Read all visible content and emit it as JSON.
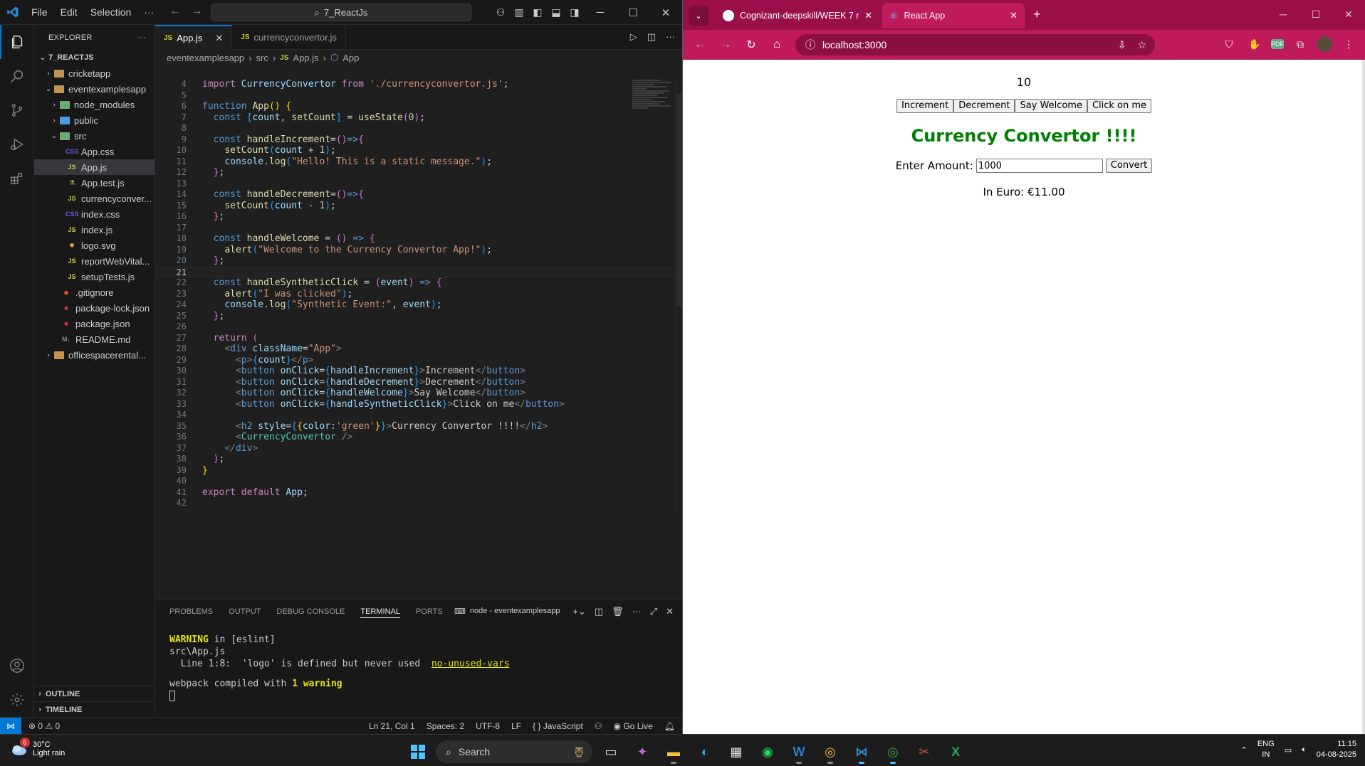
{
  "vscode": {
    "menu": [
      "File",
      "Edit",
      "Selection",
      "···"
    ],
    "search_text": "7_ReactJs",
    "explorer_title": "EXPLORER",
    "explorer_more": "···",
    "tree": [
      {
        "label": "7_REACTJS",
        "depth": 0,
        "kind": "root",
        "open": true
      },
      {
        "label": "cricketapp",
        "depth": 1,
        "kind": "folder",
        "open": false
      },
      {
        "label": "eventexamplesapp",
        "depth": 1,
        "kind": "folder",
        "open": true
      },
      {
        "label": "node_modules",
        "depth": 2,
        "kind": "folder-green",
        "open": false
      },
      {
        "label": "public",
        "depth": 2,
        "kind": "folder-blue",
        "open": false
      },
      {
        "label": "src",
        "depth": 2,
        "kind": "folder-green",
        "open": true
      },
      {
        "label": "App.css",
        "depth": 3,
        "kind": "css"
      },
      {
        "label": "App.js",
        "depth": 3,
        "kind": "js",
        "selected": true
      },
      {
        "label": "App.test.js",
        "depth": 3,
        "kind": "test"
      },
      {
        "label": "currencyconver...",
        "depth": 3,
        "kind": "js"
      },
      {
        "label": "index.css",
        "depth": 3,
        "kind": "css"
      },
      {
        "label": "index.js",
        "depth": 3,
        "kind": "js"
      },
      {
        "label": "logo.svg",
        "depth": 3,
        "kind": "svg"
      },
      {
        "label": "reportWebVital...",
        "depth": 3,
        "kind": "js"
      },
      {
        "label": "setupTests.js",
        "depth": 3,
        "kind": "js"
      },
      {
        "label": ".gitignore",
        "depth": 2,
        "kind": "git"
      },
      {
        "label": "package-lock.json",
        "depth": 2,
        "kind": "npm"
      },
      {
        "label": "package.json",
        "depth": 2,
        "kind": "npm"
      },
      {
        "label": "README.md",
        "depth": 2,
        "kind": "md"
      },
      {
        "label": "officespacerental...",
        "depth": 1,
        "kind": "folder",
        "open": false
      }
    ],
    "outline_label": "OUTLINE",
    "timeline_label": "TIMELINE",
    "tabs": [
      {
        "icon": "JS",
        "label": "App.js",
        "active": true,
        "close": "✕"
      },
      {
        "icon": "JS",
        "label": "currencyconvertor.js",
        "active": false,
        "close": ""
      }
    ],
    "breadcrumb": [
      "eventexamplesapp",
      "src",
      "App.js",
      "App"
    ],
    "code_lines": [
      {
        "n": "4",
        "html": "<span class='kw'>import</span> <span class='v'>CurrencyConvertor</span> <span class='kw'>from</span> <span class='s'>'./currencyconvertor.js'</span>;"
      },
      {
        "n": "5",
        "html": ""
      },
      {
        "n": "6",
        "html": "<span class='k'>function</span> <span class='f'>App</span><span class='by'>()</span> <span class='by'>{</span>"
      },
      {
        "n": "7",
        "html": "  <span class='k'>const</span> <span class='br2'>[</span><span class='v'>count</span>, <span class='f'>setCount</span><span class='br2'>]</span> = <span class='f'>useState</span><span class='br'>(</span><span class='n'>0</span><span class='br'>)</span>;"
      },
      {
        "n": "8",
        "html": ""
      },
      {
        "n": "9",
        "html": "  <span class='k'>const</span> <span class='f'>handleIncrement</span>=<span class='br'>()</span><span class='k'>=&gt;</span><span class='br'>{</span>"
      },
      {
        "n": "10",
        "html": "    <span class='f'>setCount</span><span class='br2'>(</span><span class='v'>count</span> + <span class='n'>1</span><span class='br2'>)</span>;"
      },
      {
        "n": "11",
        "html": "    <span class='v'>console</span>.<span class='f'>log</span><span class='br2'>(</span><span class='s'>\"Hello! This is a static message.\"</span><span class='br2'>)</span>;"
      },
      {
        "n": "12",
        "html": "  <span class='br'>}</span>;"
      },
      {
        "n": "13",
        "html": ""
      },
      {
        "n": "14",
        "html": "  <span class='k'>const</span> <span class='f'>handleDecrement</span>=<span class='br'>()</span><span class='k'>=&gt;</span><span class='br'>{</span>"
      },
      {
        "n": "15",
        "html": "    <span class='f'>setCount</span><span class='br2'>(</span><span class='v'>count</span> - <span class='n'>1</span><span class='br2'>)</span>;"
      },
      {
        "n": "16",
        "html": "  <span class='br'>}</span>;"
      },
      {
        "n": "17",
        "html": ""
      },
      {
        "n": "18",
        "html": "  <span class='k'>const</span> <span class='f'>handleWelcome</span> = <span class='br'>()</span> <span class='k'>=&gt;</span> <span class='br'>{</span>"
      },
      {
        "n": "19",
        "html": "    <span class='f'>alert</span><span class='br2'>(</span><span class='s'>\"Welcome to the Currency Convertor App!\"</span><span class='br2'>)</span>;"
      },
      {
        "n": "20",
        "html": "  <span class='br'>}</span>;"
      },
      {
        "n": "21",
        "html": "",
        "current": true
      },
      {
        "n": "22",
        "html": "  <span class='k'>const</span> <span class='f'>handleSyntheticClick</span> = <span class='br'>(</span><span class='v'>event</span><span class='br'>)</span> <span class='k'>=&gt;</span> <span class='br'>{</span>"
      },
      {
        "n": "23",
        "html": "    <span class='f'>alert</span><span class='br2'>(</span><span class='s'>\"I was clicked\"</span><span class='br2'>)</span>;"
      },
      {
        "n": "24",
        "html": "    <span class='v'>console</span>.<span class='f'>log</span><span class='br2'>(</span><span class='s'>\"Synthetic Event:\"</span>, <span class='v'>event</span><span class='br2'>)</span>;"
      },
      {
        "n": "25",
        "html": "  <span class='br'>}</span>;"
      },
      {
        "n": "26",
        "html": ""
      },
      {
        "n": "27",
        "html": "  <span class='kw'>return</span> <span class='br'>(</span>"
      },
      {
        "n": "28",
        "html": "    <span class='p'>&lt;</span><span class='tag'>div</span> <span class='v'>className</span>=<span class='s'>\"App\"</span><span class='p'>&gt;</span>"
      },
      {
        "n": "29",
        "html": "      <span class='p'>&lt;</span><span class='tag'>p</span><span class='p'>&gt;</span><span class='br2'>{</span><span class='v'>count</span><span class='br2'>}</span><span class='p'>&lt;/</span><span class='tag'>p</span><span class='p'>&gt;</span>"
      },
      {
        "n": "30",
        "html": "      <span class='p'>&lt;</span><span class='tag'>button</span> <span class='v'>onClick</span>=<span class='br2'>{</span><span class='v'>handleIncrement</span><span class='br2'>}</span><span class='p'>&gt;</span>Increment<span class='p'>&lt;/</span><span class='tag'>button</span><span class='p'>&gt;</span>"
      },
      {
        "n": "31",
        "html": "      <span class='p'>&lt;</span><span class='tag'>button</span> <span class='v'>onClick</span>=<span class='br2'>{</span><span class='v'>handleDecrement</span><span class='br2'>}</span><span class='p'>&gt;</span>Decrement<span class='p'>&lt;/</span><span class='tag'>button</span><span class='p'>&gt;</span>"
      },
      {
        "n": "32",
        "html": "      <span class='p'>&lt;</span><span class='tag'>button</span> <span class='v'>onClick</span>=<span class='br2'>{</span><span class='v'>handleWelcome</span><span class='br2'>}</span><span class='p'>&gt;</span>Say Welcome<span class='p'>&lt;/</span><span class='tag'>button</span><span class='p'>&gt;</span>"
      },
      {
        "n": "33",
        "html": "      <span class='p'>&lt;</span><span class='tag'>button</span> <span class='v'>onClick</span>=<span class='br2'>{</span><span class='v'>handleSyntheticClick</span><span class='br2'>}</span><span class='p'>&gt;</span>Click on me<span class='p'>&lt;/</span><span class='tag'>button</span><span class='p'>&gt;</span>"
      },
      {
        "n": "34",
        "html": ""
      },
      {
        "n": "35",
        "html": "      <span class='p'>&lt;</span><span class='tag'>h2</span> <span class='v'>style</span>=<span class='br2'>{</span><span class='by'>{</span><span class='v'>color</span>:<span class='s'>'green'</span><span class='by'>}</span><span class='br2'>}</span><span class='p'>&gt;</span>Currency Convertor !!!!<span class='p'>&lt;/</span><span class='tag'>h2</span><span class='p'>&gt;</span>"
      },
      {
        "n": "36",
        "html": "      <span class='p'>&lt;</span><span class='t'>CurrencyConvertor</span> <span class='p'>/&gt;</span>"
      },
      {
        "n": "37",
        "html": "    <span class='p'>&lt;/</span><span class='tag'>div</span><span class='p'>&gt;</span>"
      },
      {
        "n": "38",
        "html": "  <span class='br'>)</span>;"
      },
      {
        "n": "39",
        "html": "<span class='by'>}</span>"
      },
      {
        "n": "40",
        "html": ""
      },
      {
        "n": "41",
        "html": "<span class='kw'>export</span> <span class='kw'>default</span> <span class='v'>App</span>;"
      },
      {
        "n": "42",
        "html": ""
      }
    ],
    "panel_tabs": [
      "PROBLEMS",
      "OUTPUT",
      "DEBUG CONSOLE",
      "TERMINAL",
      "PORTS"
    ],
    "active_panel_tab": "TERMINAL",
    "terminal_name": "node - eventexamplesapp",
    "terminal": {
      "warning_word": "WARNING",
      "warning_rest": " in [eslint]",
      "file": "src\\App.js",
      "line_prefix": "  Line 1:8:  'logo' is defined but never used  ",
      "rule": "no-unused-vars",
      "compiled_prefix": "webpack compiled with ",
      "compiled_bold": "1 warning"
    },
    "status": {
      "errors": "⊗ 0 ⚠ 0",
      "position": "Ln 21, Col 1",
      "spaces": "Spaces: 2",
      "encoding": "UTF-8",
      "eol": "LF",
      "language": "{ } JavaScript",
      "golive": "Go Live"
    }
  },
  "chrome": {
    "tabs": [
      {
        "title": "Cognizant-deepskill/WEEK 7 re",
        "active": false
      },
      {
        "title": "React App",
        "active": true
      }
    ],
    "url": "localhost:3000",
    "app": {
      "count": "10",
      "buttons": [
        "Increment",
        "Decrement",
        "Say Welcome",
        "Click on me"
      ],
      "heading": "Currency Convertor !!!!",
      "heading_color": "#008000",
      "amount_label": "Enter Amount:",
      "amount_value": "1000",
      "convert_label": "Convert",
      "result": "In Euro: €11.00"
    }
  },
  "taskbar": {
    "weather_temp": "30°C",
    "weather_desc": "Light rain",
    "weather_badge": "6",
    "search_placeholder": "Search",
    "lang_top": "ENG",
    "lang_bottom": "IN",
    "time": "11:15",
    "date": "04-08-2025"
  }
}
